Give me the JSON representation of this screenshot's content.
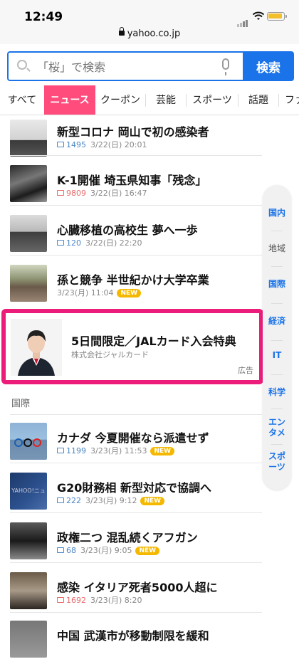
{
  "status": {
    "time": "12:49",
    "url": "yahoo.co.jp"
  },
  "search": {
    "placeholder": "「桜」で検索",
    "button": "検索"
  },
  "tabs": [
    "すべて",
    "ニュース",
    "クーポン",
    "芸能",
    "スポーツ",
    "話題",
    "ファ"
  ],
  "news": [
    {
      "title": "新型コロナ 岡山で初の感染者",
      "comments": "1495",
      "date": "3/22(日) 20:01",
      "hot": false,
      "new": false
    },
    {
      "title": "K-1開催 埼玉県知事「残念」",
      "comments": "9809",
      "date": "3/22(日) 16:47",
      "hot": true,
      "new": false
    },
    {
      "title": "心臓移植の高校生 夢へ一歩",
      "comments": "120",
      "date": "3/22(日) 22:20",
      "hot": false,
      "new": false
    },
    {
      "title": "孫と競争 半世紀かけ大学卒業",
      "comments": "",
      "date": "3/23(月) 11:04",
      "hot": false,
      "new": true
    }
  ],
  "ad": {
    "title": "5日間限定／JALカード入会特典",
    "sponsor": "株式会社ジャルカード",
    "label": "広告"
  },
  "section": "国際",
  "intl": [
    {
      "title": "カナダ 今夏開催なら派遣せず",
      "comments": "1199",
      "date": "3/23(月) 11:53",
      "hot": false,
      "new": true
    },
    {
      "title": "G20財務相 新型対応で協調へ",
      "comments": "222",
      "date": "3/23(月) 9:12",
      "hot": false,
      "new": true,
      "thumb_text": "YAHOO!ニュース"
    },
    {
      "title": "政権二つ 混乱続くアフガン",
      "comments": "68",
      "date": "3/23(月) 9:05",
      "hot": false,
      "new": true
    },
    {
      "title": "感染 イタリア死者5000人超に",
      "comments": "1692",
      "date": "3/23(月) 8:20",
      "hot": true,
      "new": false
    },
    {
      "title": "中国 武漢市が移動制限を緩和",
      "comments": "",
      "date": "",
      "hot": false,
      "new": false
    }
  ],
  "new_label": "NEW",
  "index": [
    "国内",
    "地域",
    "国際",
    "経済",
    "IT",
    "科学",
    "エンタメ",
    "スポーツ"
  ],
  "colors": {
    "accent": "#1a73e8",
    "news_tab": "#ff4c7c",
    "ad_border": "#ec1d7a",
    "new_badge": "#f5b800"
  }
}
